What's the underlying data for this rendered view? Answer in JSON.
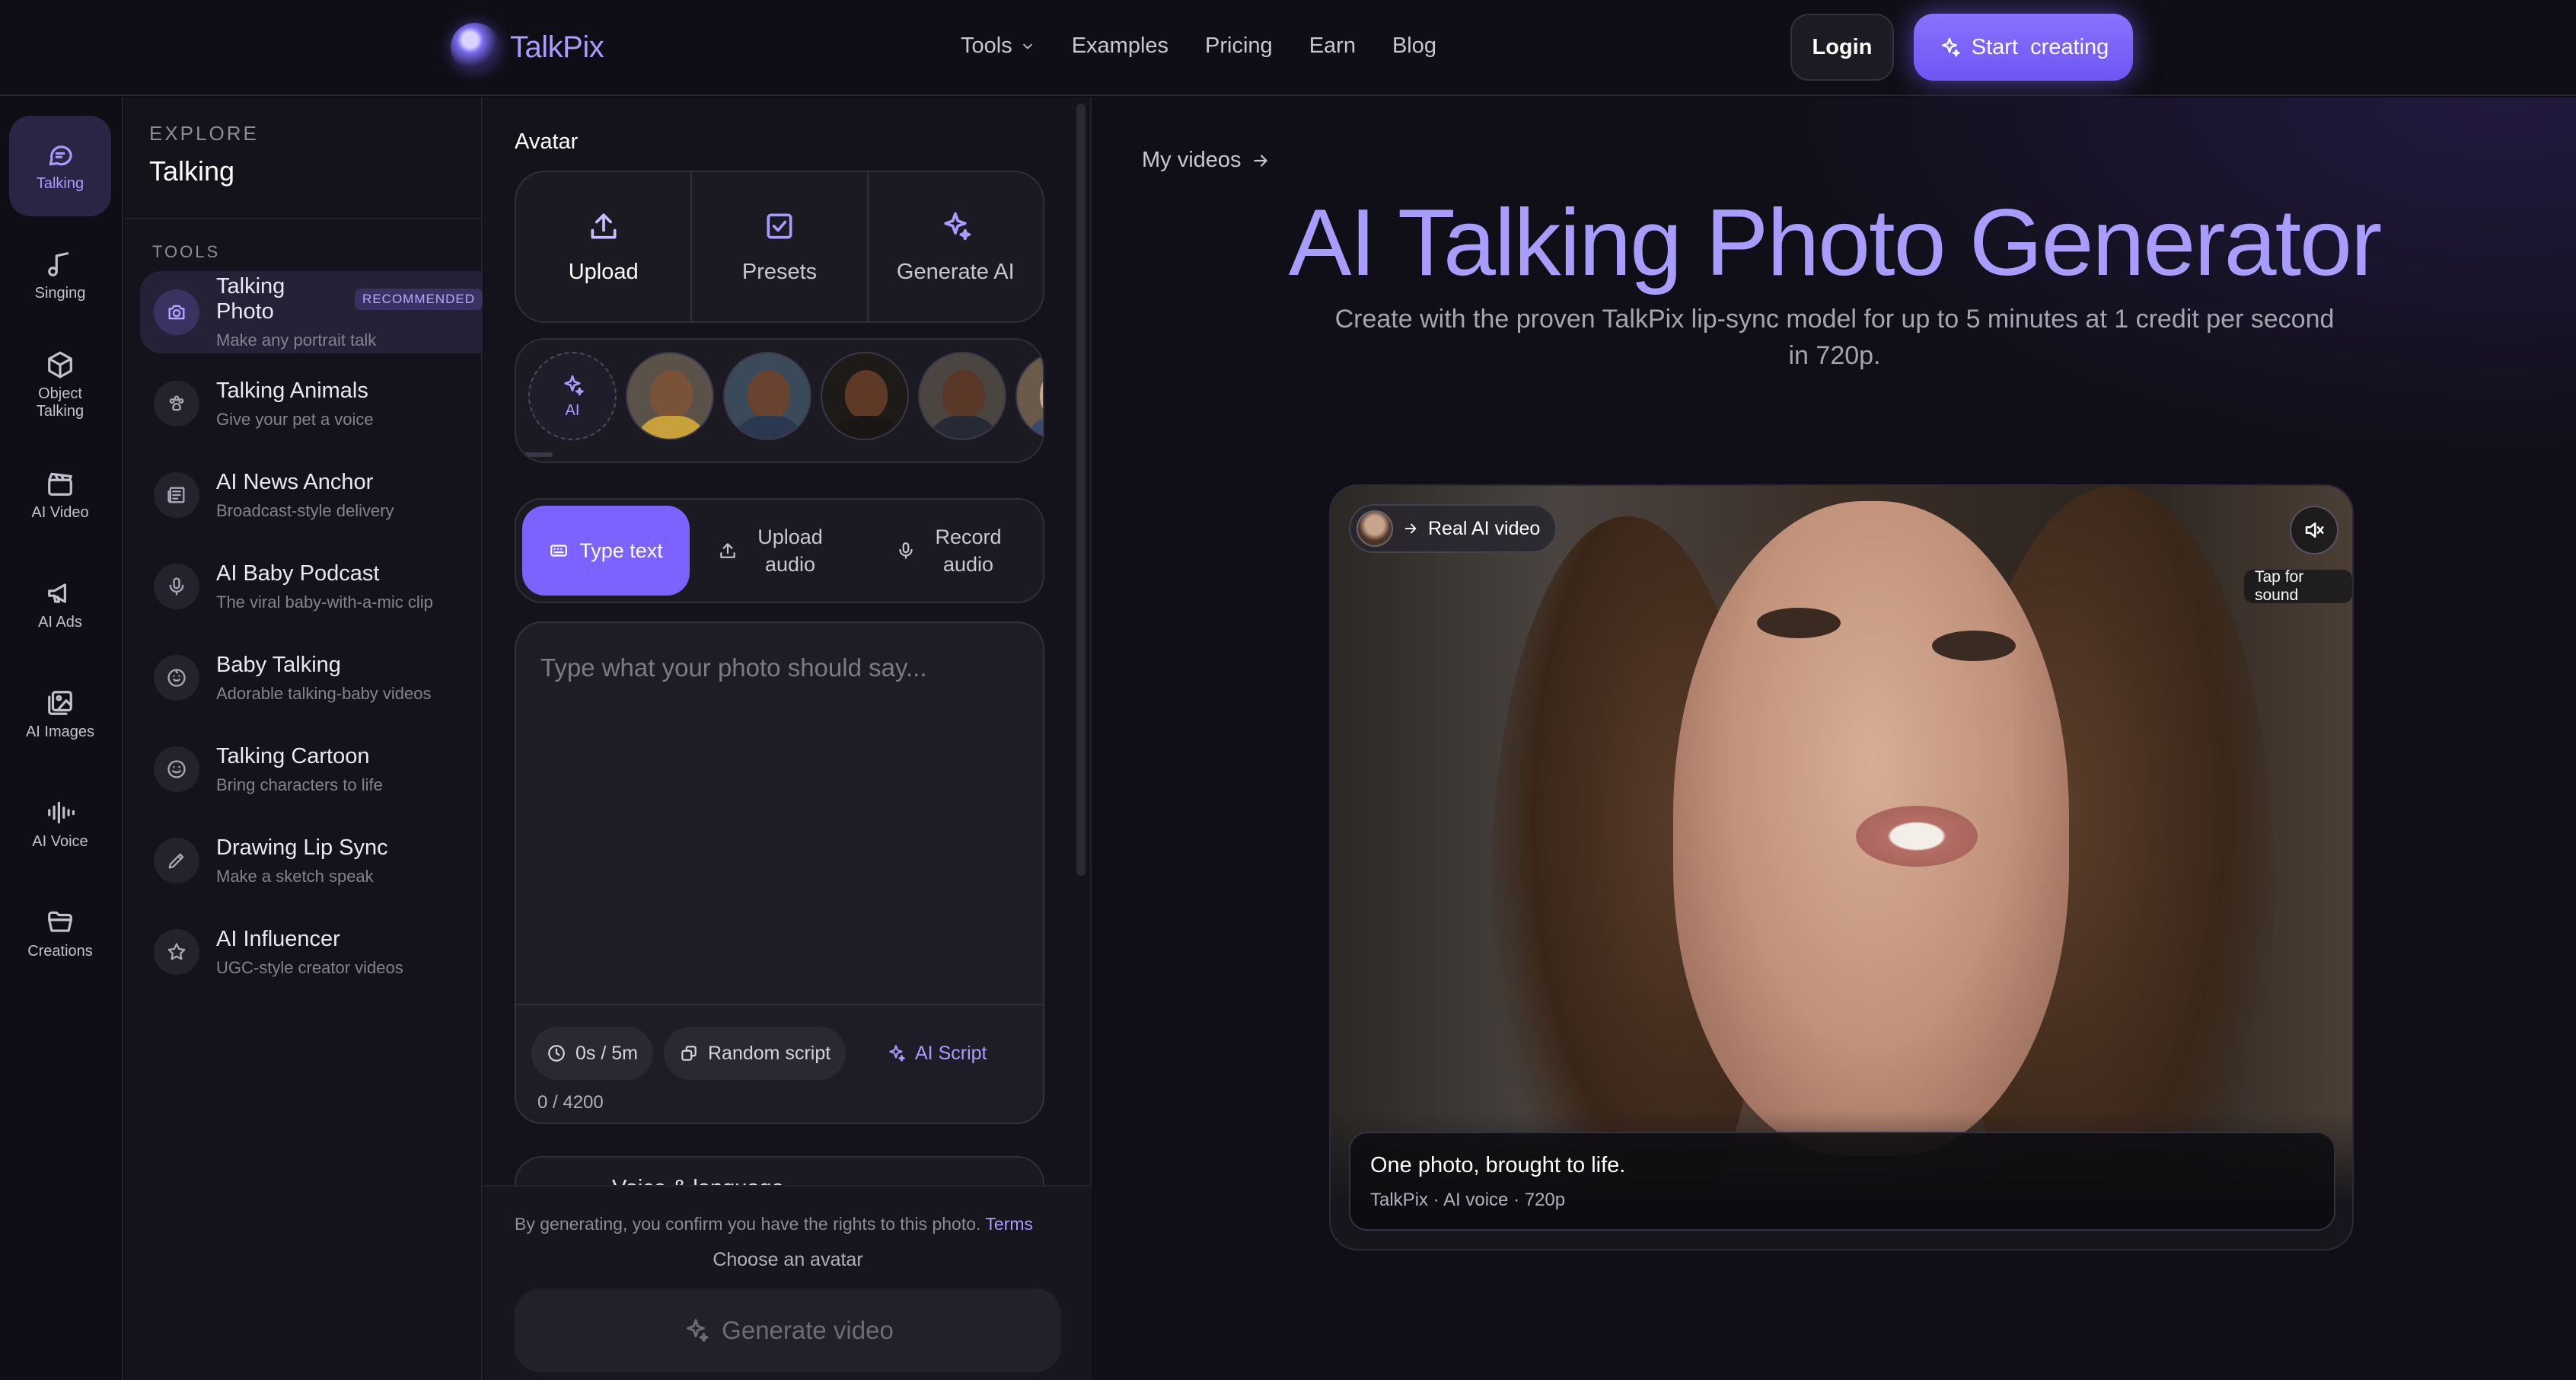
{
  "brand": {
    "name": "TalkPix"
  },
  "nav": {
    "items": [
      "Tools",
      "Examples",
      "Pricing",
      "Earn",
      "Blog"
    ],
    "login": "Login",
    "start": "Start  creating"
  },
  "rail": {
    "items": [
      {
        "label": "Talking",
        "icon": "chat-bubble-icon"
      },
      {
        "label": "Singing",
        "icon": "music-note-icon"
      },
      {
        "label": "Object Talking",
        "icon": "cube-icon"
      },
      {
        "label": "AI Video",
        "icon": "clapperboard-icon"
      },
      {
        "label": "AI Ads",
        "icon": "megaphone-icon"
      },
      {
        "label": "AI Images",
        "icon": "image-icon"
      },
      {
        "label": "AI Voice",
        "icon": "waveform-icon"
      },
      {
        "label": "Creations",
        "icon": "folder-icon"
      }
    ]
  },
  "tools": {
    "kicker": "EXPLORE",
    "title": "Talking",
    "section": "TOOLS",
    "badge": "RECOMMENDED",
    "items": [
      {
        "title": "Talking Photo",
        "sub": "Make any portrait talk",
        "icon": "camera-icon"
      },
      {
        "title": "Talking Animals",
        "sub": "Give your pet a voice",
        "icon": "paw-icon"
      },
      {
        "title": "AI News Anchor",
        "sub": "Broadcast-style delivery",
        "icon": "newspaper-icon"
      },
      {
        "title": "AI Baby Podcast",
        "sub": "The viral baby-with-a-mic clip",
        "icon": "microphone-icon"
      },
      {
        "title": "Baby Talking",
        "sub": "Adorable talking-baby videos",
        "icon": "baby-face-icon"
      },
      {
        "title": "Talking Cartoon",
        "sub": "Bring characters to life",
        "icon": "smiley-icon"
      },
      {
        "title": "Drawing Lip Sync",
        "sub": "Make a sketch speak",
        "icon": "pencil-icon"
      },
      {
        "title": "AI Influencer",
        "sub": "UGC-style creator videos",
        "icon": "star-icon"
      }
    ]
  },
  "editor": {
    "avatar_label": "Avatar",
    "sources": [
      "Upload",
      "Presets",
      "Generate AI"
    ],
    "ai_chip": "AI",
    "modes": [
      "Type text",
      "Upload audio",
      "Record audio"
    ],
    "placeholder": "Type what your photo should say...",
    "duration": "0s / 5m",
    "random_script": "Random script",
    "ai_script": "AI Script",
    "char_count": "0 / 4200",
    "voice_section": "Voice & language",
    "consent": "By generating, you confirm you have the rights to this photo.",
    "terms": "Terms",
    "choose_avatar": "Choose an avatar",
    "generate": "Generate video"
  },
  "main": {
    "my_videos": "My videos",
    "title": "AI Talking Photo Generator",
    "subtitle": "Create with the proven TalkPix lip-sync model for up to 5 minutes at 1 credit per second in 720p.",
    "video": {
      "chip": "Real AI video",
      "tap_sound": "Tap for sound",
      "caption_title": "One photo, brought to life.",
      "caption_meta": "TalkPix · AI voice · 720p"
    }
  },
  "colors": {
    "accent": "#7c63ff",
    "accent_text": "#a99cff",
    "background": "#0f0e16"
  }
}
